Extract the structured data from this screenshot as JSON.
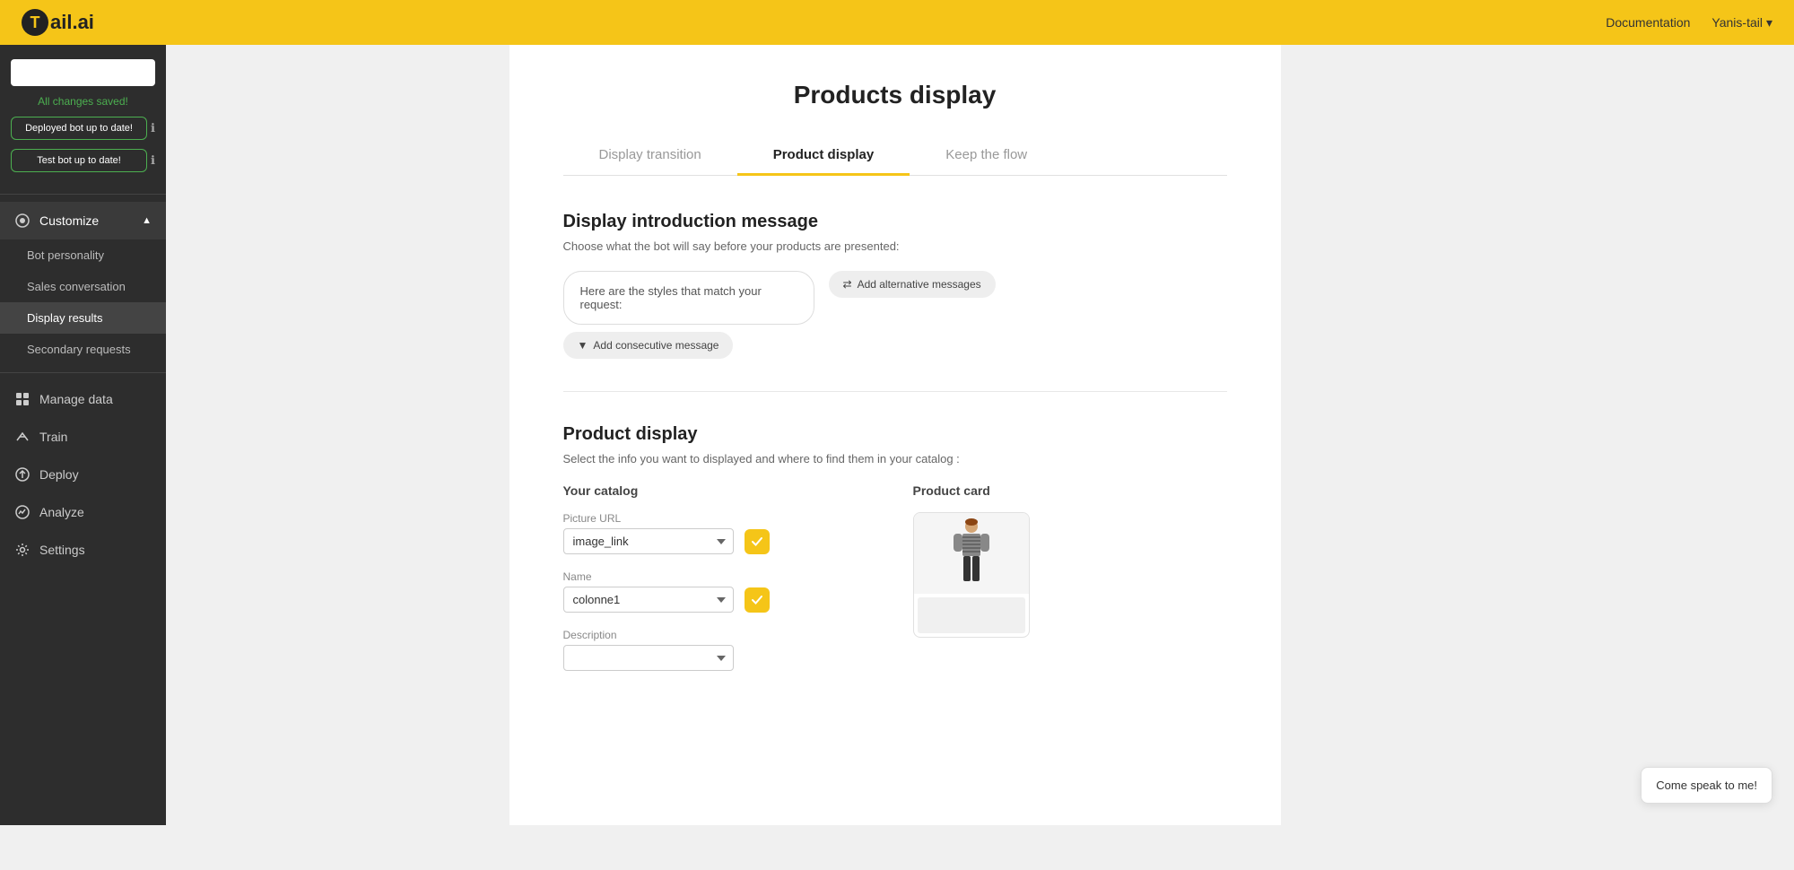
{
  "header": {
    "logo_text": "ail.ai",
    "logo_t": "T",
    "doc_link": "Documentation",
    "user_name": "Yanis-tail",
    "chevron": "▾"
  },
  "sidebar": {
    "saved_text": "All changes saved!",
    "deploy_btn": "Deployed bot up to date!",
    "test_btn": "Test bot up to date!",
    "customize_label": "Customize",
    "sub_items": [
      {
        "label": "Bot personality"
      },
      {
        "label": "Sales conversation"
      },
      {
        "label": "Display results"
      },
      {
        "label": "Secondary requests"
      }
    ],
    "nav_items": [
      {
        "label": "Manage data",
        "icon": "grid-icon"
      },
      {
        "label": "Train",
        "icon": "train-icon"
      },
      {
        "label": "Deploy",
        "icon": "deploy-icon"
      },
      {
        "label": "Analyze",
        "icon": "analyze-icon"
      },
      {
        "label": "Settings",
        "icon": "settings-icon"
      }
    ]
  },
  "main": {
    "page_title": "Products display",
    "tabs": [
      {
        "label": "Display transition"
      },
      {
        "label": "Product display",
        "active": true
      },
      {
        "label": "Keep the flow"
      }
    ],
    "intro_section": {
      "title": "Display introduction message",
      "subtitle": "Choose what the bot will say before your products are presented:",
      "message_text": "Here are the styles that match your request:",
      "alt_messages_btn": "Add alternative messages",
      "consecutive_btn": "Add consecutive message"
    },
    "product_section": {
      "title": "Product display",
      "subtitle": "Select the info you want to displayed and where to find them in your catalog :",
      "your_catalog_label": "Your catalog",
      "product_card_label": "Product card",
      "fields": [
        {
          "label": "Picture URL",
          "value": "image_link"
        },
        {
          "label": "Name",
          "value": "colonne1"
        },
        {
          "label": "Description",
          "value": ""
        }
      ]
    }
  },
  "chat_bubble": {
    "text": "Come speak to me!"
  }
}
